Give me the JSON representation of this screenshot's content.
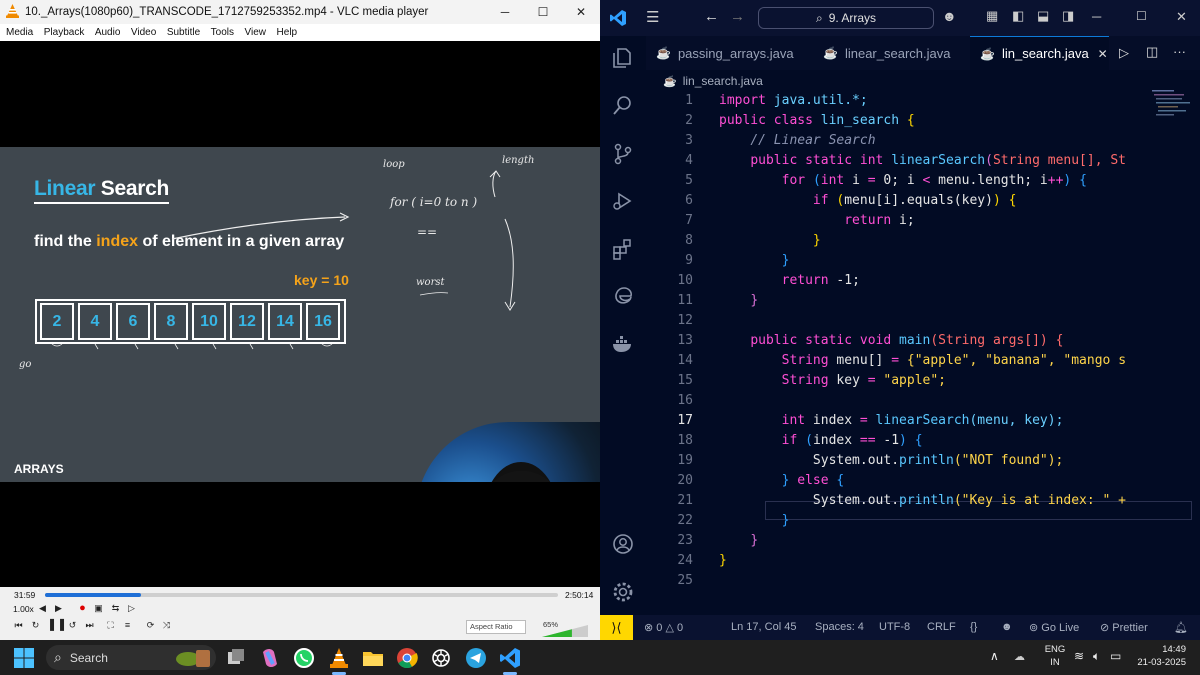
{
  "vlc": {
    "title": "10._Arrays(1080p60)_TRANSCODE_1712759253352.mp4 - VLC media player",
    "menu": [
      "Media",
      "Playback",
      "Audio",
      "Video",
      "Subtitle",
      "Tools",
      "View",
      "Help"
    ],
    "slide": {
      "title_hl": "Linear",
      "title_rest": " Search",
      "subtitle_pre": "find the ",
      "subtitle_hl": "index",
      "subtitle_post": " of element in a given array",
      "key_label": "key = 10",
      "array": [
        "2",
        "4",
        "6",
        "8",
        "10",
        "12",
        "14",
        "16"
      ],
      "footer": "ARRAYS",
      "handwriting": {
        "loop": "loop",
        "for": "for ( i=0 to n )",
        "length": "length",
        "worst": "worst",
        "eq": "==",
        "go": "go"
      }
    },
    "controls": {
      "time_elapsed": "31:59",
      "time_total": "2:50:14",
      "progress": 0.188,
      "rate": "1.00x",
      "aspect": "Aspect Ratio",
      "volume": "65%"
    }
  },
  "vscode": {
    "search": "9. Arrays",
    "tabs": [
      {
        "label": "passing_arrays.java",
        "active": false
      },
      {
        "label": "linear_search.java",
        "active": false
      },
      {
        "label": "lin_search.java",
        "active": true
      }
    ],
    "breadcrumb": "lin_search.java",
    "line_numbers": [
      "1",
      "2",
      "3",
      "4",
      "5",
      "6",
      "7",
      "8",
      "9",
      "10",
      "11",
      "12",
      "13",
      "14",
      "15",
      "16",
      "17",
      "18",
      "19",
      "20",
      "21",
      "22",
      "23",
      "24",
      "25"
    ],
    "current_line": "17",
    "code": {
      "l1a": "import",
      "l1b": " java.util.*;",
      "l2a": "public class",
      "l2b": " lin_search ",
      "l2c": "{",
      "l3": "// Linear Search",
      "l4a": "public static int ",
      "l4b": "linearSearch",
      "l4c": "(",
      "l4d": "String menu[], St",
      "l5a": "for ",
      "l5b": "(",
      "l5c": "int",
      "l5d": " i ",
      "l5e": "=",
      "l5f": " 0; i ",
      "l5g": "<",
      "l5h": " menu.length; i",
      "l5i": "++",
      "l5j": ") {",
      "l6a": "if ",
      "l6b": "(",
      "l6c": "menu[i].equals(key)",
      "l6d": ") {",
      "l7a": "return",
      "l7b": " i;",
      "l8": "}",
      "l9": "}",
      "l10a": "return",
      "l10b": " -1;",
      "l11": "}",
      "l13a": "public static void ",
      "l13b": "main",
      "l13c": "(String args[]) {",
      "l14a": "String",
      "l14b": " menu[] ",
      "l14c": "=",
      "l14d": " {\"apple\", \"banana\", \"mango s",
      "l15a": "String",
      "l15b": " key ",
      "l15c": "=",
      "l15d": " \"apple\";",
      "l17a": "int",
      "l17b": " index ",
      "l17c": "=",
      "l17d": " linearSearch",
      "l17e": "(menu, key);",
      "l18a": "if ",
      "l18b": "(",
      "l18c": "index ",
      "l18d": "==",
      "l18e": " -1",
      "l18f": ") {",
      "l19a": "System.out.",
      "l19b": "println",
      "l19c": "(\"NOT found\");",
      "l20a": "} ",
      "l20b": "else",
      "l20c": " {",
      "l21a": "System.out.",
      "l21b": "println",
      "l21c": "(\"Key is at index: \" +",
      "l22": "}",
      "l23": "}",
      "l24": "}"
    },
    "status": {
      "problems_errors": "0",
      "problems_warnings": "0",
      "position": "Ln 17, Col 45",
      "spaces": "Spaces: 4",
      "encoding": "UTF-8",
      "eol": "CRLF",
      "lang": "{}",
      "golive": "Go Live",
      "prettier": "Prettier"
    }
  },
  "taskbar": {
    "search": "Search",
    "lang": "ENG",
    "region": "IN",
    "time": "14:49",
    "date": "21-03-2025"
  }
}
